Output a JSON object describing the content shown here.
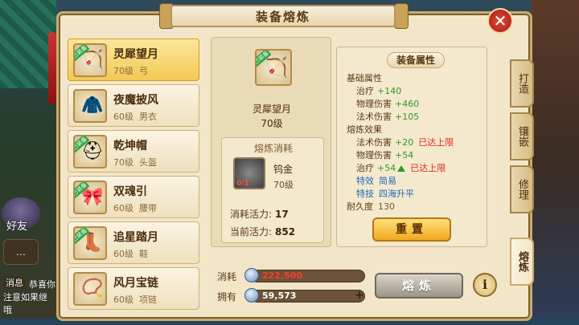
{
  "window": {
    "title": "装备熔炼",
    "close_icon": "close-icon"
  },
  "background": {
    "friend_label": "好友",
    "message_label": "消息",
    "chat_lines": [
      "恭喜你",
      "注意如果继",
      "哦"
    ]
  },
  "equipment_list": [
    {
      "name": "灵犀望月",
      "level": "70级",
      "type": "弓",
      "badge": "已装备",
      "icon": "bow-icon",
      "selected": true
    },
    {
      "name": "夜魔披风",
      "level": "60级",
      "type": "男衣",
      "badge": "",
      "icon": "cloak-icon",
      "selected": false
    },
    {
      "name": "乾坤帽",
      "level": "70级",
      "type": "头盔",
      "badge": "已装备",
      "icon": "helmet-icon",
      "selected": false
    },
    {
      "name": "双魂引",
      "level": "60级",
      "type": "腰带",
      "badge": "已装备",
      "icon": "belt-icon",
      "selected": false
    },
    {
      "name": "追星踏月",
      "level": "60级",
      "type": "鞋",
      "badge": "已装备",
      "icon": "boots-icon",
      "selected": false
    },
    {
      "name": "风月宝链",
      "level": "60级",
      "type": "项链",
      "badge": "",
      "icon": "necklace-icon",
      "selected": false
    }
  ],
  "selected": {
    "name": "灵犀望月",
    "level": "70级",
    "badge": "已装备",
    "cost_title": "熔炼消耗",
    "material_name": "钨金",
    "material_level": "70级",
    "material_count": "0/1",
    "energy_cost_label": "消耗活力:",
    "energy_cost": "17",
    "energy_current_label": "当前活力:",
    "energy_current": "852"
  },
  "attributes": {
    "title": "装备属性",
    "base_heading": "基础属性",
    "base": [
      {
        "label": "治疗",
        "value": "+140"
      },
      {
        "label": "物理伤害",
        "value": "+460"
      },
      {
        "label": "法术伤害",
        "value": "+105"
      }
    ],
    "refine_heading": "熔炼效果",
    "refine": [
      {
        "label": "法术伤害",
        "value": "+20",
        "cap": "已达上限"
      },
      {
        "label": "物理伤害",
        "value": "+54",
        "cap": ""
      },
      {
        "label": "治疗",
        "value": "+54",
        "cap": "已达上限"
      }
    ],
    "effect_label": "特效",
    "effect_value": "简易",
    "skill_label": "特技",
    "skill_value": "四海升平",
    "durability_label": "耐久度",
    "durability_value": "130",
    "reset_label": "重置"
  },
  "bottom": {
    "cost_label": "消耗",
    "cost_value": "222,500",
    "own_label": "拥有",
    "own_value": "59,573",
    "plus_label": "+",
    "refine_label": "熔炼",
    "info_label": "i"
  },
  "tabs": [
    "打造",
    "镶嵌",
    "修理",
    "熔炼"
  ],
  "active_tab": "熔炼",
  "colors": {
    "value_green": "#2f9a22",
    "cap_red": "#e02a1a",
    "effect_blue": "#1d68c2",
    "cost_red": "#ff3b2b"
  }
}
